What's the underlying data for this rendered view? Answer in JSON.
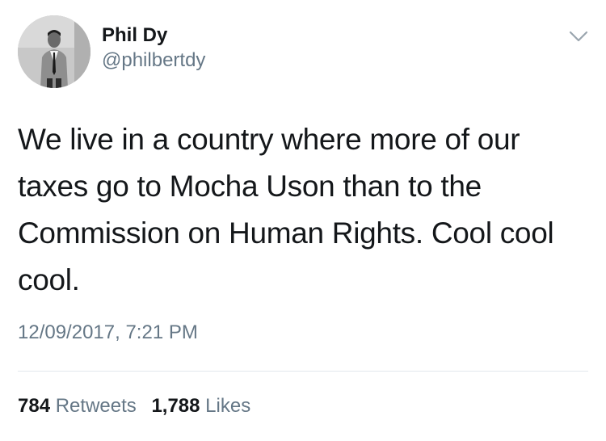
{
  "user": {
    "display_name": "Phil Dy",
    "handle": "@philbertdy"
  },
  "tweet": {
    "text": "We live in a country where more of our taxes go to Mocha Uson than to the Commission on Human Rights. Cool cool cool.",
    "timestamp": "12/09/2017, 7:21 PM"
  },
  "stats": {
    "retweets_count": "784",
    "retweets_label": "Retweets",
    "likes_count": "1,788",
    "likes_label": "Likes"
  },
  "icons": {
    "menu": "chevron-down-icon"
  },
  "colors": {
    "text": "#14171a",
    "secondary": "#657786",
    "divider": "#e1e8ed"
  }
}
